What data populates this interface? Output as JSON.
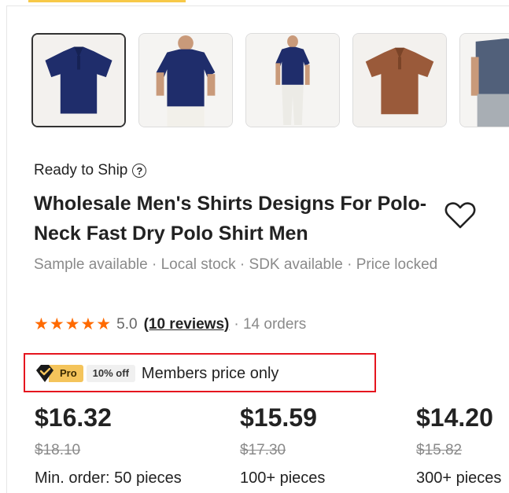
{
  "thumbnails": [
    {
      "icon": "navy-polo-flat-icon",
      "selected": true
    },
    {
      "icon": "navy-polo-model-front-icon",
      "selected": false
    },
    {
      "icon": "navy-polo-model-full-icon",
      "selected": false
    },
    {
      "icon": "brown-polo-flat-icon",
      "selected": false
    },
    {
      "icon": "grey-polo-model-icon",
      "selected": false
    }
  ],
  "product": {
    "ready_label": "Ready to Ship",
    "title": "Wholesale Men's Shirts Designs For Polo- Neck Fast Dry Polo Shirt Men",
    "meta": "Sample available · Local stock · SDK available · Price locked",
    "stars": "★★★★★",
    "rating": "5.0",
    "reviews": "(10 reviews)",
    "orders": "· 14 orders"
  },
  "membership": {
    "badge": "Pro",
    "discount": "10% off",
    "text": "Members price only"
  },
  "price_tiers": [
    {
      "price": "$16.32",
      "original": "$18.10",
      "quantity": "Min. order: 50 pieces"
    },
    {
      "price": "$15.59",
      "original": "$17.30",
      "quantity": "100+ pieces"
    },
    {
      "price": "$14.20",
      "original": "$15.82",
      "quantity": "300+ pieces"
    }
  ],
  "colors": {
    "star": "#ff6a00",
    "highlight_border": "#e5151f",
    "pro_gold": "#f4c45b",
    "navy": "#1f2d6b",
    "brown": "#9a5a3a"
  }
}
